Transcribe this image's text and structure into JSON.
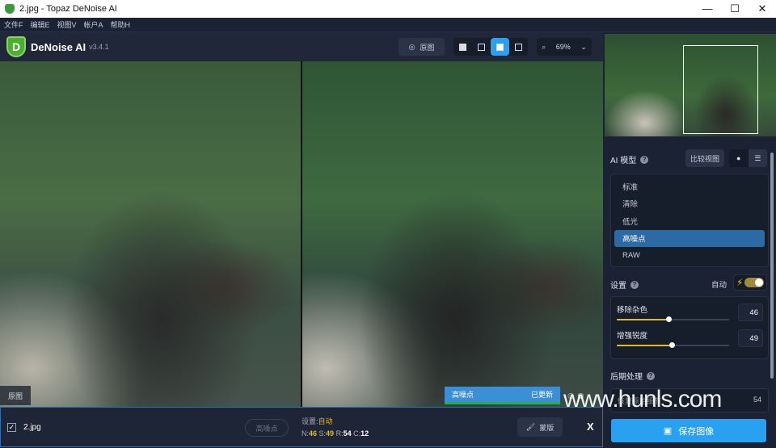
{
  "window": {
    "title": "2.jpg - Topaz DeNoise AI",
    "min": "—",
    "max": "☐",
    "close": "✕"
  },
  "menu": [
    "文件F",
    "编辑E",
    "视图V",
    "帐户A",
    "帮助H"
  ],
  "app": {
    "logo_letter": "D",
    "name": "DeNoise AI",
    "version": "v3.4.1"
  },
  "toolbar": {
    "original_label": "原图",
    "zoom": "69%"
  },
  "preview": {
    "original_label": "原图",
    "status_model": "高噪点",
    "status_text": "已更新"
  },
  "bottom": {
    "filename": "2.jpg",
    "model_pill": "高噪点",
    "settings_label": "设置:",
    "settings_value": "自动",
    "n_label": "N:",
    "n": "46",
    "s_label": "S:",
    "s": "49",
    "r_label": "R:",
    "r": "54",
    "c_label": "C:",
    "c": "12",
    "mask_label": "蒙版",
    "close": "X"
  },
  "panel": {
    "ai_model_label": "AI 模型",
    "compare_label": "比较视图",
    "models": [
      "标准",
      "清除",
      "低光",
      "高噪点",
      "RAW"
    ],
    "selected_model": "高噪点",
    "settings_label": "设置",
    "auto_label": "自动",
    "auto_on": true,
    "sliders": [
      {
        "label": "移除杂色",
        "value": "46",
        "fraction": 0.46
      },
      {
        "label": "增强锐度",
        "value": "49",
        "fraction": 0.49
      }
    ],
    "post_label": "后期处理",
    "post_item": "恢复原始细节",
    "post_value": "54",
    "save_label": "保存图像"
  },
  "watermark": "www.hunls.com",
  "colors": {
    "accent": "#2aa0f0",
    "slider": "#e3b534",
    "selected": "#2c6aa5",
    "status_ok": "#27b04a"
  }
}
